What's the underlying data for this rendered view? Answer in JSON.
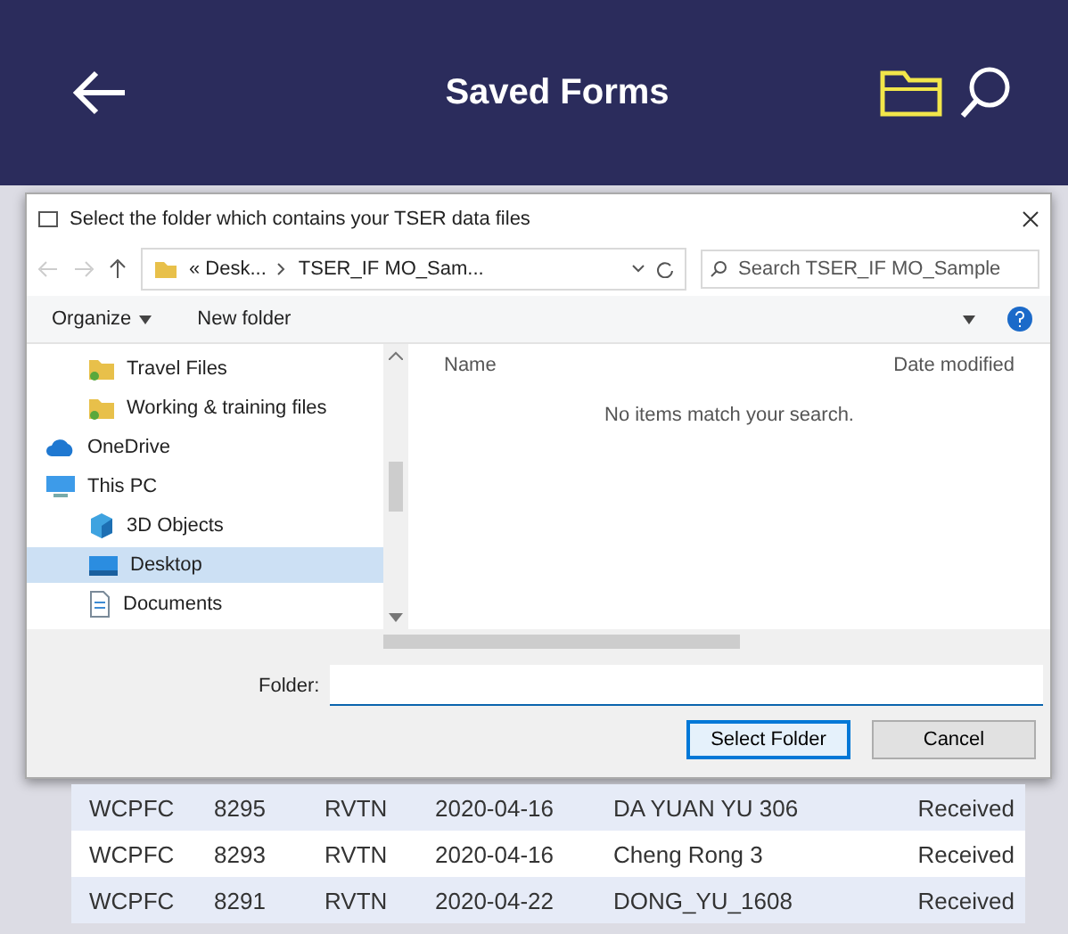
{
  "header": {
    "title": "Saved Forms"
  },
  "dialog": {
    "title": "Select the folder which contains your TSER data files",
    "address": {
      "path": [
        "« Desk...",
        "TSER_IF MO_Sam..."
      ]
    },
    "search": {
      "placeholder": "Search TSER_IF MO_Sample"
    },
    "toolbar": {
      "organize": "Organize",
      "new_folder": "New folder"
    },
    "nav": {
      "pinned": [
        {
          "label": "Travel Files",
          "kind": "folder",
          "selected": false
        },
        {
          "label": "Working & training files",
          "kind": "folder",
          "selected": false
        }
      ],
      "items": [
        {
          "label": "OneDrive",
          "kind": "cloud",
          "selected": false
        },
        {
          "label": "This PC",
          "kind": "pc",
          "selected": false,
          "children": [
            {
              "label": "3D Objects",
              "kind": "objects",
              "selected": false
            },
            {
              "label": "Desktop",
              "kind": "desktop",
              "selected": true
            },
            {
              "label": "Documents",
              "kind": "documents",
              "selected": false
            }
          ]
        }
      ]
    },
    "columns": [
      "Name",
      "Date modified"
    ],
    "empty_message": "No items match your search.",
    "folder": {
      "label": "Folder:"
    },
    "buttons": [
      {
        "label": "Select Folder",
        "default": true
      },
      {
        "label": "Cancel",
        "default": false
      }
    ]
  },
  "table": {
    "rows": [
      [
        "WCPFC",
        "8295",
        "RVTN",
        "2020-04-16",
        "DA YUAN YU 306",
        "Received"
      ],
      [
        "WCPFC",
        "8293",
        "RVTN",
        "2020-04-16",
        "Cheng Rong 3",
        "Received"
      ],
      [
        "WCPFC",
        "8291",
        "RVTN",
        "2020-04-22",
        "DONG_YU_1608",
        "Received"
      ]
    ]
  }
}
